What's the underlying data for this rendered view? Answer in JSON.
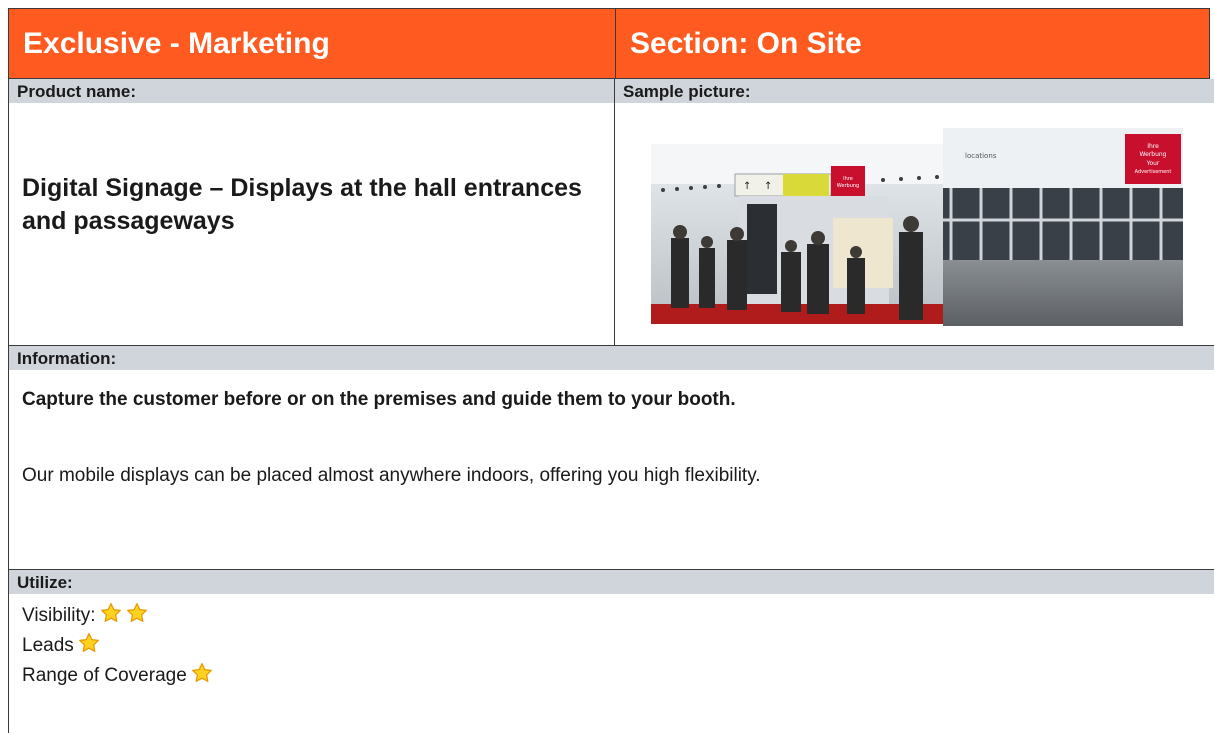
{
  "header": {
    "left_title": "Exclusive - Marketing",
    "right_title": "Section: On Site",
    "accent_color": "#ff5a1f"
  },
  "product": {
    "label": "Product name:",
    "name": "Digital Signage – Displays at the hall entrances and passageways"
  },
  "sample": {
    "label": "Sample picture:",
    "left_sign_text": "Ihre Werbung Your Advertisement",
    "right_sign_text": "Ihre Werbung Your Advertisement"
  },
  "information": {
    "label": "Information:",
    "headline": "Capture the customer before or on the premises and guide them to your booth.",
    "body": "Our mobile displays can be placed almost anywhere indoors, offering you high flexibility."
  },
  "utilize": {
    "label": "Utilize:",
    "ratings": [
      {
        "label": "Visibility:",
        "stars": 2
      },
      {
        "label": "Leads",
        "stars": 1
      },
      {
        "label": "Range of Coverage",
        "stars": 1
      }
    ]
  }
}
